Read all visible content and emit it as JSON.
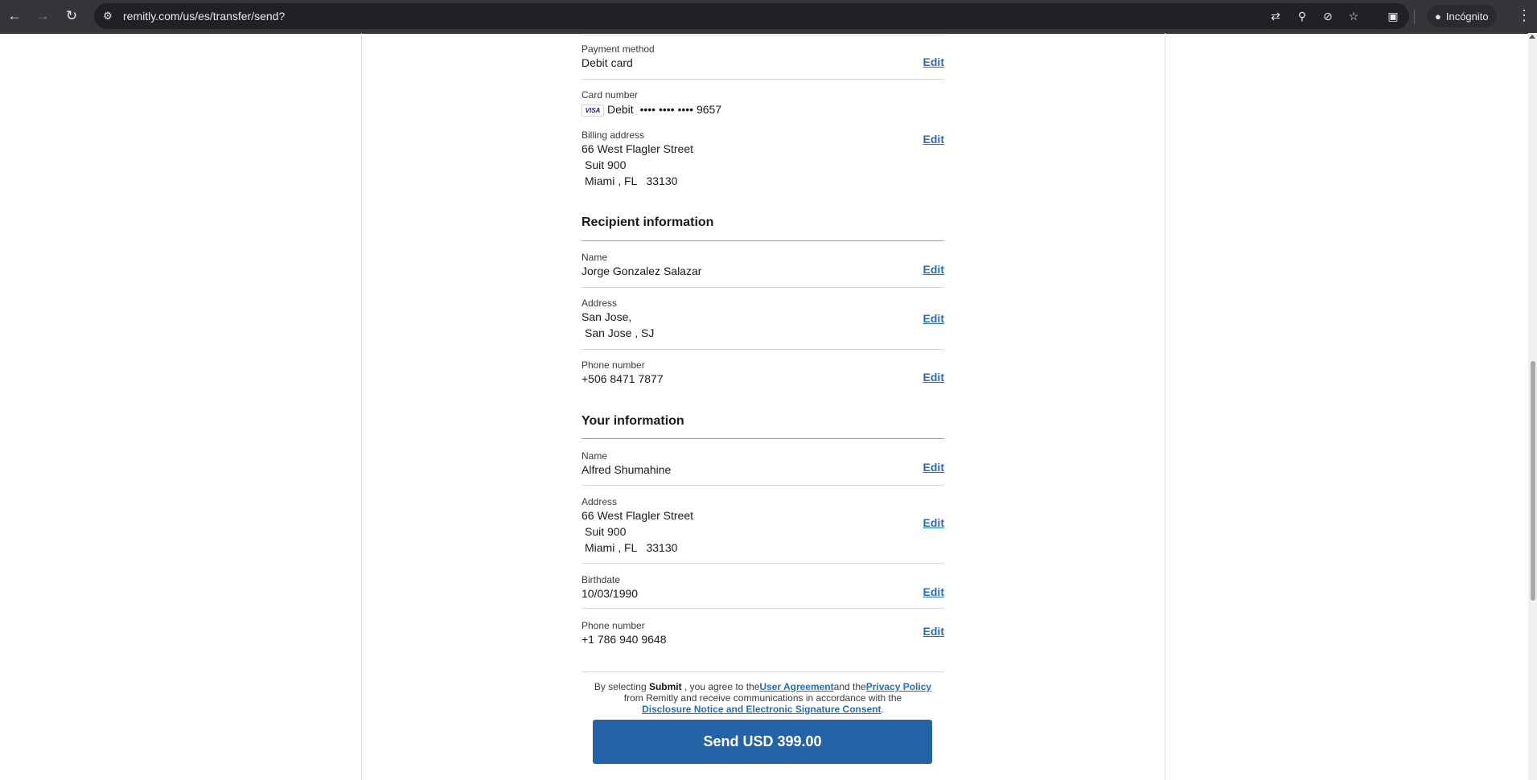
{
  "browser": {
    "url": "remitly.com/us/es/transfer/send?",
    "profile_label": "Incógnito",
    "icons": [
      "back-icon",
      "forward-icon",
      "reload-icon",
      "site-info-icon",
      "translate-icon",
      "zoom-icon",
      "eye-off-icon",
      "star-icon",
      "tab-search-icon",
      "incognito-icon",
      "menu-icon"
    ]
  },
  "payment": {
    "method_label": "Payment method",
    "method_value": "Debit card",
    "card_label": "Card number",
    "card_brand": "VISA",
    "card_type": "Debit",
    "card_masked": "•••• •••• •••• 9657",
    "billing_label": "Billing address",
    "billing_line1": "66 West Flagler Street",
    "billing_line2": "Suit 900",
    "billing_line3": "Miami , FL   33130",
    "edit_label": "Edit"
  },
  "recipient": {
    "title": "Recipient information",
    "name_label": "Name",
    "name_value": "Jorge Gonzalez Salazar",
    "address_label": "Address",
    "address_line1": "San Jose,",
    "address_line2": "San Jose , SJ",
    "phone_label": "Phone number",
    "phone_value": "+506 8471 7877"
  },
  "you": {
    "title": "Your information",
    "name_label": "Name",
    "name_value": "Alfred Shumahine",
    "address_label": "Address",
    "address_line1": "66 West Flagler Street",
    "address_line2": "Suit 900",
    "address_line3": "Miami , FL   33130",
    "birthdate_label": "Birthdate",
    "birthdate_value": "10/03/1990",
    "phone_label": "Phone number",
    "phone_value": "+1 786 940 9648"
  },
  "legal": {
    "prefix": "By selecting ",
    "submit_word": "Submit",
    "middle": " , you agree to the",
    "user_agreement": "User Agreement",
    "and_the": "and the",
    "privacy_policy": "Privacy Policy",
    "line2": "from Remitly and receive communications in accordance with the",
    "disclosure": "Disclosure Notice and Electronic Signature Consent",
    "period": "."
  },
  "send_button": "Send USD 399.00"
}
